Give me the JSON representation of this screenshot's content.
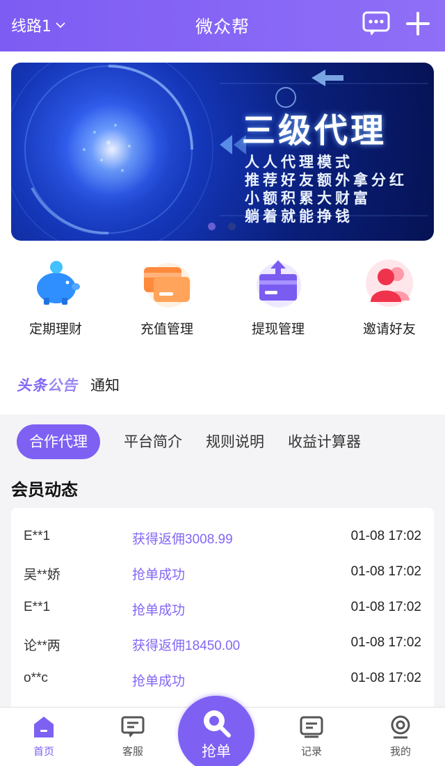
{
  "header": {
    "route_label": "线路1",
    "title": "微众帮"
  },
  "banner": {
    "title": "三级代理",
    "lines": [
      "人人代理模式",
      "推荐好友额外拿分红",
      "小额积累大财富",
      "躺着就能挣钱"
    ]
  },
  "quick_actions": [
    {
      "label": "定期理财",
      "icon": "piggy-bank-icon"
    },
    {
      "label": "充值管理",
      "icon": "card-icon"
    },
    {
      "label": "提现管理",
      "icon": "withdraw-icon"
    },
    {
      "label": "邀请好友",
      "icon": "invite-friends-icon"
    }
  ],
  "notice": {
    "badge_part1": "头条",
    "badge_part2": "公告",
    "text": "通知"
  },
  "tabs": [
    {
      "label": "合作代理",
      "active": true
    },
    {
      "label": "平台简介",
      "active": false
    },
    {
      "label": "规则说明",
      "active": false
    },
    {
      "label": "收益计算器",
      "active": false
    }
  ],
  "members_title": "会员动态",
  "members": [
    {
      "name": "E**1",
      "action": "获得返佣3008.99",
      "time": "01-08 17:02"
    },
    {
      "name": "吴**娇",
      "action": "抢单成功",
      "time": "01-08 17:02"
    },
    {
      "name": "E**1",
      "action": "抢单成功",
      "time": "01-08 17:02"
    },
    {
      "name": "论**两",
      "action": "获得返佣18450.00",
      "time": "01-08 17:02"
    },
    {
      "name": "o**c",
      "action": "抢单成功",
      "time": "01-08 17:02"
    }
  ],
  "bottom_nav": {
    "home": "首页",
    "service": "客服",
    "grab": "抢单",
    "records": "记录",
    "mine": "我的"
  },
  "colors": {
    "primary": "#7e60f3",
    "header": "#8466f5"
  }
}
